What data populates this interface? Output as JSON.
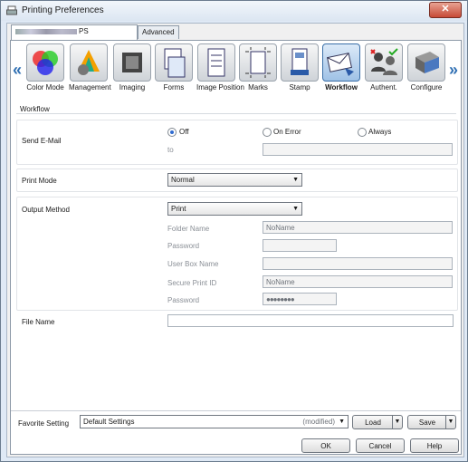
{
  "window": {
    "title": "Printing Preferences",
    "close_glyph": "✕"
  },
  "tabs": [
    {
      "label": "PS"
    },
    {
      "label": "Advanced"
    }
  ],
  "toolbar": {
    "left_arrow": "«",
    "right_arrow": "»",
    "items": [
      {
        "label": "Color Mode",
        "icon": "color-mode-icon"
      },
      {
        "label": "Management",
        "icon": "management-icon"
      },
      {
        "label": "Imaging",
        "icon": "imaging-icon"
      },
      {
        "label": "Forms",
        "icon": "forms-icon"
      },
      {
        "label": "Image Position",
        "icon": "image-position-icon"
      },
      {
        "label": "Marks",
        "icon": "marks-icon"
      },
      {
        "label": "Stamp",
        "icon": "stamp-icon"
      },
      {
        "label": "Workflow",
        "icon": "workflow-icon"
      },
      {
        "label": "Authent.",
        "icon": "authentication-icon"
      },
      {
        "label": "Configure",
        "icon": "configure-icon"
      }
    ],
    "selected": "Workflow"
  },
  "workflow": {
    "section_title": "Workflow",
    "send_email": {
      "label": "Send E-Mail",
      "options": [
        "Off",
        "On Error",
        "Always"
      ],
      "selected": "Off",
      "to_label": "to",
      "to_value": ""
    },
    "print_mode": {
      "label": "Print Mode",
      "value": "Normal"
    },
    "output_method": {
      "label": "Output Method",
      "value": "Print",
      "folder_name_label": "Folder Name",
      "folder_name_value": "NoName",
      "password_label": "Password",
      "password_value": "",
      "user_box_name_label": "User Box Name",
      "user_box_name_value": "",
      "secure_print_id_label": "Secure Print ID",
      "secure_print_id_value": "NoName",
      "secure_password_label": "Password",
      "secure_password_value": "●●●●●●●●"
    },
    "file_name": {
      "label": "File Name",
      "value": ""
    }
  },
  "favorite": {
    "label": "Favorite Setting",
    "value": "Default Settings",
    "modified": "(modified)",
    "load_label": "Load",
    "save_label": "Save"
  },
  "dialog_buttons": {
    "ok": "OK",
    "cancel": "Cancel",
    "help": "Help"
  },
  "colors": {
    "accent": "#2f6fb3",
    "close": "#c74a36"
  }
}
